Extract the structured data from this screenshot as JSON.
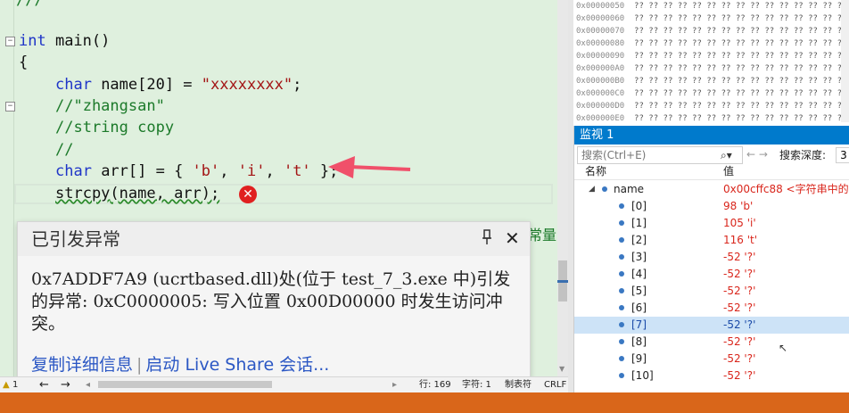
{
  "editor": {
    "top_partial": "///",
    "lines": [
      {
        "id": "main-sig",
        "kw": "int",
        "text": " main()"
      },
      {
        "id": "brace-open",
        "text": "{"
      },
      {
        "id": "decl-name",
        "kw": "char",
        "text": " name[20] = ",
        "str": "\"xxxxxxxx\"",
        "tail": ";"
      },
      {
        "id": "comment-zhangsan",
        "comment": "//\"zhangsan\""
      },
      {
        "id": "comment-strcpy",
        "comment": "//string copy"
      },
      {
        "id": "comment-empty",
        "comment": "//"
      },
      {
        "id": "decl-arr",
        "kw": "char",
        "text": " arr[] = { ",
        "s1": "'b'",
        "c1": ", ",
        "s2": "'i'",
        "c2": ", ",
        "s3": "'t'",
        "tail": " };"
      },
      {
        "id": "strcpy-call",
        "call": "strcpy",
        "text": "(name, arr);"
      }
    ],
    "error_icon_glyph": "✕",
    "behind_popup_text": "常量"
  },
  "exception_popup": {
    "title": "已引发异常",
    "message": "0x7ADDF7A9 (ucrtbased.dll)处(位于 test_7_3.exe 中)引发的异常: 0xC0000005: 写入位置 0x00D00000 时发生访问冲突。",
    "link_copy": "复制详细信息",
    "link_liveshare": "启动 Live Share 会话...",
    "pin_icon": "pin-icon",
    "close_icon": "close-icon"
  },
  "statusbar": {
    "warn_count": "1",
    "line": "行: 169",
    "char": "字符: 1",
    "tab": "制表符",
    "eol": "CRLF"
  },
  "memory": {
    "rows": [
      {
        "addr": "0x00000050",
        "vals": "?? ?? ?? ?? ?? ?? ?? ?? ?? ?? ?? ?? ?? ?? ?? ?? ??"
      },
      {
        "addr": "0x00000060",
        "vals": "?? ?? ?? ?? ?? ?? ?? ?? ?? ?? ?? ?? ?? ?? ?? ?? ??"
      },
      {
        "addr": "0x00000070",
        "vals": "?? ?? ?? ?? ?? ?? ?? ?? ?? ?? ?? ?? ?? ?? ?? ?? ??"
      },
      {
        "addr": "0x00000080",
        "vals": "?? ?? ?? ?? ?? ?? ?? ?? ?? ?? ?? ?? ?? ?? ?? ?? ??"
      },
      {
        "addr": "0x00000090",
        "vals": "?? ?? ?? ?? ?? ?? ?? ?? ?? ?? ?? ?? ?? ?? ?? ?? ??"
      },
      {
        "addr": "0x000000A0",
        "vals": "?? ?? ?? ?? ?? ?? ?? ?? ?? ?? ?? ?? ?? ?? ?? ?? ??"
      },
      {
        "addr": "0x000000B0",
        "vals": "?? ?? ?? ?? ?? ?? ?? ?? ?? ?? ?? ?? ?? ?? ?? ?? ??"
      },
      {
        "addr": "0x000000C0",
        "vals": "?? ?? ?? ?? ?? ?? ?? ?? ?? ?? ?? ?? ?? ?? ?? ?? ??"
      },
      {
        "addr": "0x000000D0",
        "vals": "?? ?? ?? ?? ?? ?? ?? ?? ?? ?? ?? ?? ?? ?? ?? ?? ??"
      },
      {
        "addr": "0x000000E0",
        "vals": "?? ?? ?? ?? ?? ?? ?? ?? ?? ?? ?? ?? ?? ?? ?? ?? ??"
      }
    ]
  },
  "watch": {
    "title": "监视 1",
    "search_placeholder": "搜索(Ctrl+E)",
    "search_depth_label": "搜索深度:",
    "search_depth_value": "3",
    "col_name": "名称",
    "col_value": "值",
    "root": {
      "name": "name",
      "value": "0x00cffc88 <字符串中的"
    },
    "children": [
      {
        "name": "[0]",
        "value": "98 'b'"
      },
      {
        "name": "[1]",
        "value": "105 'i'"
      },
      {
        "name": "[2]",
        "value": "116 't'"
      },
      {
        "name": "[3]",
        "value": "-52 '?'"
      },
      {
        "name": "[4]",
        "value": "-52 '?'"
      },
      {
        "name": "[5]",
        "value": "-52 '?'"
      },
      {
        "name": "[6]",
        "value": "-52 '?'"
      },
      {
        "name": "[7]",
        "value": "-52 '?'",
        "selected": true
      },
      {
        "name": "[8]",
        "value": "-52 '?'"
      },
      {
        "name": "[9]",
        "value": "-52 '?'"
      },
      {
        "name": "[10]",
        "value": "-52 '?'"
      }
    ]
  },
  "colors": {
    "editor_bg": "#dff0de",
    "keyword": "#1f35c8",
    "string": "#a31515",
    "comment": "#1c7a2a",
    "error": "#e02020",
    "annotation_arrow": "#f0506a",
    "watch_title_bg": "#007acc",
    "bottom_bar": "#d9661a"
  }
}
